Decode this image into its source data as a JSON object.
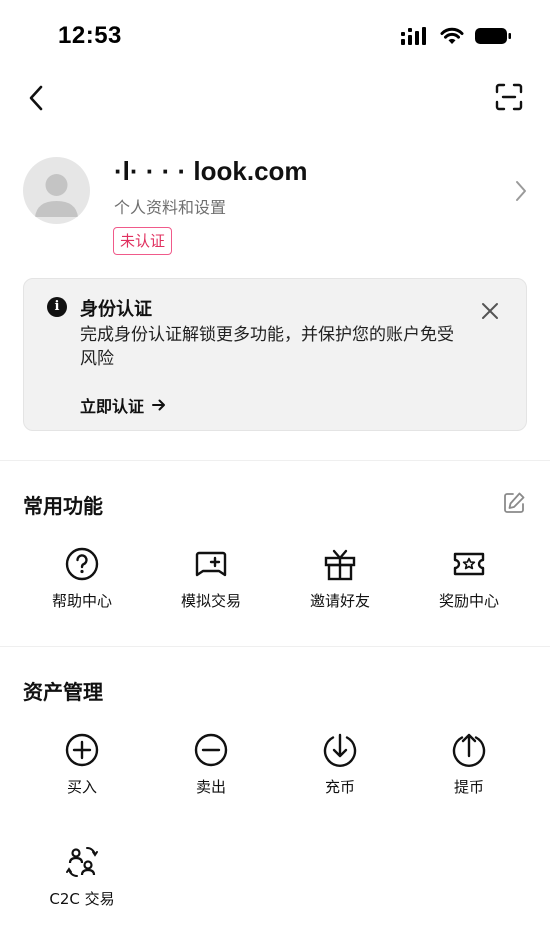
{
  "status": {
    "time": "12:53"
  },
  "profile": {
    "name": "·l·   ·  ·   ·  look.com",
    "subtitle": "个人资料和设置",
    "badge": "未认证"
  },
  "kyc": {
    "title": "身份认证",
    "description": "完成身份认证解锁更多功能，并保护您的账户免受风险",
    "action": "立即认证"
  },
  "common": {
    "title": "常用功能",
    "items": [
      {
        "label": "帮助中心",
        "icon": "help-circle-icon"
      },
      {
        "label": "模拟交易",
        "icon": "gamepad-icon"
      },
      {
        "label": "邀请好友",
        "icon": "gift-icon"
      },
      {
        "label": "奖励中心",
        "icon": "ticket-star-icon"
      }
    ]
  },
  "assets": {
    "title": "资产管理",
    "items": [
      {
        "label": "买入",
        "icon": "plus-circle-icon"
      },
      {
        "label": "卖出",
        "icon": "minus-circle-icon"
      },
      {
        "label": "充币",
        "icon": "deposit-icon"
      },
      {
        "label": "提币",
        "icon": "withdraw-icon"
      },
      {
        "label": "C2C 交易",
        "icon": "c2c-users-icon"
      }
    ]
  },
  "colors": {
    "badge": "#e0305f",
    "card_bg": "#f2f2f2"
  }
}
